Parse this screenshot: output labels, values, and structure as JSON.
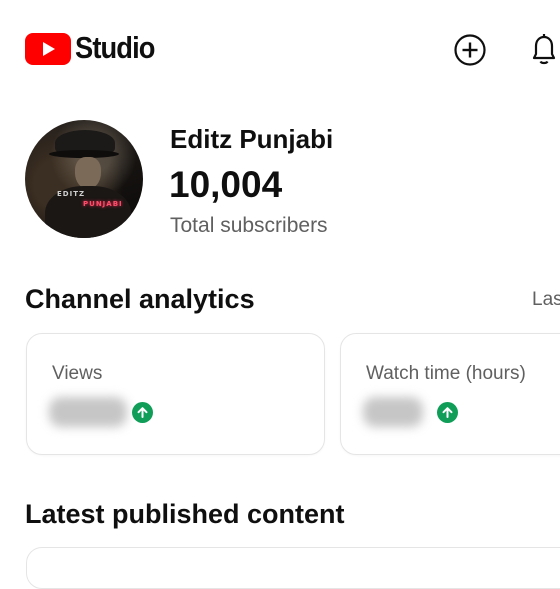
{
  "header": {
    "brand": "Studio",
    "logo_icon": "youtube-logo-icon",
    "create_icon": "add-circle-icon",
    "notifications_icon": "bell-icon"
  },
  "channel": {
    "name": "Editz Punjabi",
    "subscriber_count": "10,004",
    "subscriber_label": "Total subscribers",
    "avatar_watermark": [
      "EDITZ",
      "PUNJABI"
    ]
  },
  "analytics": {
    "title": "Channel analytics",
    "period_link": "Las",
    "cards": [
      {
        "label": "Views",
        "value_hidden": true,
        "trend": "up"
      },
      {
        "label": "Watch time (hours)",
        "value_hidden": true,
        "trend": "up"
      }
    ]
  },
  "latest": {
    "title": "Latest published content"
  },
  "colors": {
    "brand_red": "#ff0000",
    "trend_green": "#0f9d58",
    "secondary_text": "#606060"
  }
}
